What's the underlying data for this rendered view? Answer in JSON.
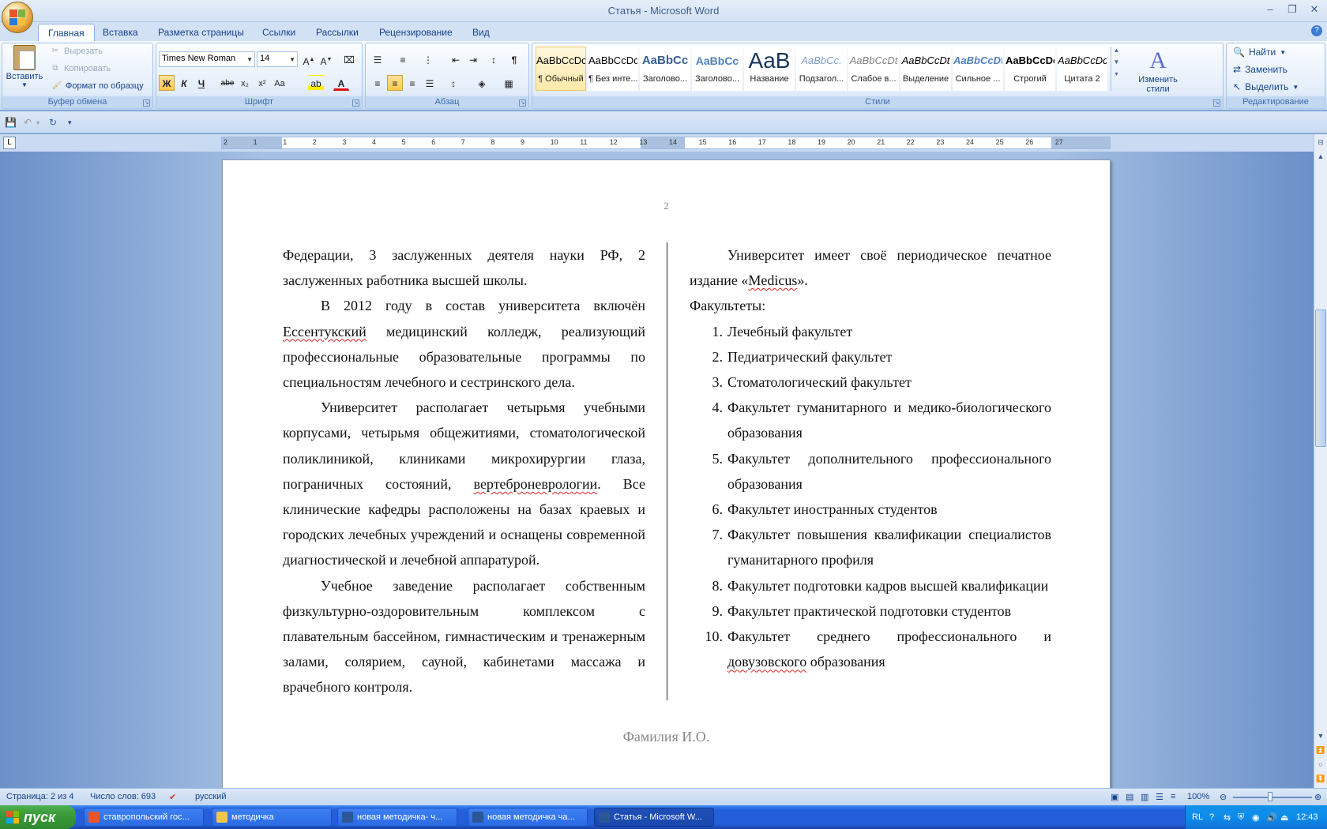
{
  "window": {
    "title": "Статья - Microsoft Word",
    "controls": [
      "minimize-icon",
      "restore-icon",
      "close-icon"
    ]
  },
  "tabs": [
    "Главная",
    "Вставка",
    "Разметка страницы",
    "Ссылки",
    "Рассылки",
    "Рецензирование",
    "Вид"
  ],
  "active_tab": "Главная",
  "ribbon": {
    "clipboard": {
      "label": "Буфер обмена",
      "paste": "Вставить",
      "cut": "Вырезать",
      "copy": "Копировать",
      "format_painter": "Формат по образцу"
    },
    "font": {
      "label": "Шрифт",
      "font_name": "Times New Roman",
      "font_size": "14",
      "bold": "Ж",
      "italic": "К",
      "underline": "Ч",
      "strikethrough": "abe",
      "subscript": "x₂",
      "superscript": "x²",
      "change_case": "Aa"
    },
    "paragraph": {
      "label": "Абзац"
    },
    "styles": {
      "label": "Стили",
      "items": [
        {
          "sample": "AaBbCcDc",
          "name": "¶ Обычный"
        },
        {
          "sample": "AaBbCcDc",
          "name": "¶ Без инте..."
        },
        {
          "sample": "AaBbCc",
          "name": "Заголово..."
        },
        {
          "sample": "AaBbCc",
          "name": "Заголово..."
        },
        {
          "sample": "AaB",
          "name": "Название"
        },
        {
          "sample": "AaBbCc.",
          "name": "Подзагол..."
        },
        {
          "sample": "AaBbCcDt",
          "name": "Слабое в..."
        },
        {
          "sample": "AaBbCcDt",
          "name": "Выделение"
        },
        {
          "sample": "AaBbCcDt",
          "name": "Сильное ..."
        },
        {
          "sample": "AaBbCcDc",
          "name": "Строгий"
        },
        {
          "sample": "AaBbCcDc",
          "name": "Цитата 2"
        }
      ],
      "change_styles": "Изменить стили"
    },
    "editing": {
      "label": "Редактирование",
      "find": "Найти",
      "replace": "Заменить",
      "select": "Выделить"
    }
  },
  "ruler": {
    "numbers": [
      "2",
      "1",
      "1",
      "2",
      "3",
      "4",
      "5",
      "6",
      "7",
      "8",
      "9",
      "10",
      "11",
      "12",
      "13",
      "14",
      "15",
      "16",
      "17",
      "18",
      "19",
      "20",
      "21",
      "22",
      "23",
      "24",
      "25",
      "26",
      "27"
    ]
  },
  "document": {
    "page_number": "2",
    "left_column": [
      "Федерации, 3 заслуженных деятеля науки РФ, 2 заслуженных работника высшей школы.",
      "В 2012 году в состав университета включён Ессентукский медицинский колледж, реализующий профессиональные образовательные программы по специальностям лечебного и сестринского дела.",
      "Университет располагает четырьмя учебными корпусами, четырьмя общежитиями, стоматологической поликлиникой, клиниками микрохирургии глаза, пограничных состояний, вертеброневрологии. Все клинические кафедры расположены на базах краевых и городских лечебных учреждений и оснащены современной диагностической и лечебной аппаратурой.",
      "Учебное заведение располагает собственным физкультурно-оздоровительным комплексом с плавательным бассейном, гимнастическим и тренажерным залами, солярием, сауной, кабинетами массажа и врачебного контроля."
    ],
    "right_intro": "Университет имеет своё периодическое печатное издание «Medicus».",
    "faculties_heading": "Факультеты:",
    "faculties": [
      {
        "n": "1.",
        "text": "Лечебный факультет"
      },
      {
        "n": "2.",
        "text": "Педиатрический факультет"
      },
      {
        "n": "3.",
        "text": "Стоматологический факультет"
      },
      {
        "n": "4.",
        "text": "Факультет гуманитарного и медико-биологического образования"
      },
      {
        "n": "5.",
        "text": "Факультет дополнительного профессионального образования"
      },
      {
        "n": "6.",
        "text": "Факультет иностранных студентов"
      },
      {
        "n": "7.",
        "text": "Факультет повышения квалификации специалистов гуманитарного профиля"
      },
      {
        "n": "8.",
        "text": "Факультет подготовки кадров высшей квалификации"
      },
      {
        "n": "9.",
        "text": "Факультет практической подготовки студентов"
      },
      {
        "n": "10.",
        "text": "Факультет среднего профессионального и довузовского образования"
      }
    ],
    "footer_name": "Фамилия И.О."
  },
  "statusbar": {
    "page": "Страница: 2 из 4",
    "words": "Число слов: 693",
    "language": "русский",
    "zoom": "100%",
    "zoom_level": 1.0
  },
  "taskbar": {
    "start": "пуск",
    "tasks": [
      {
        "label": "ставропольский гос...",
        "icon_color": "#e8562a"
      },
      {
        "label": "методичка",
        "icon_color": "#f1c64a"
      },
      {
        "label": "новая методичка- ч...",
        "icon_color": "#2b5797"
      },
      {
        "label": "новая методичка ча...",
        "icon_color": "#2b5797"
      },
      {
        "label": "Статья - Microsoft W...",
        "icon_color": "#2b5797"
      }
    ],
    "active_task": 4,
    "tray_lang": "RL",
    "clock": "12:43"
  }
}
